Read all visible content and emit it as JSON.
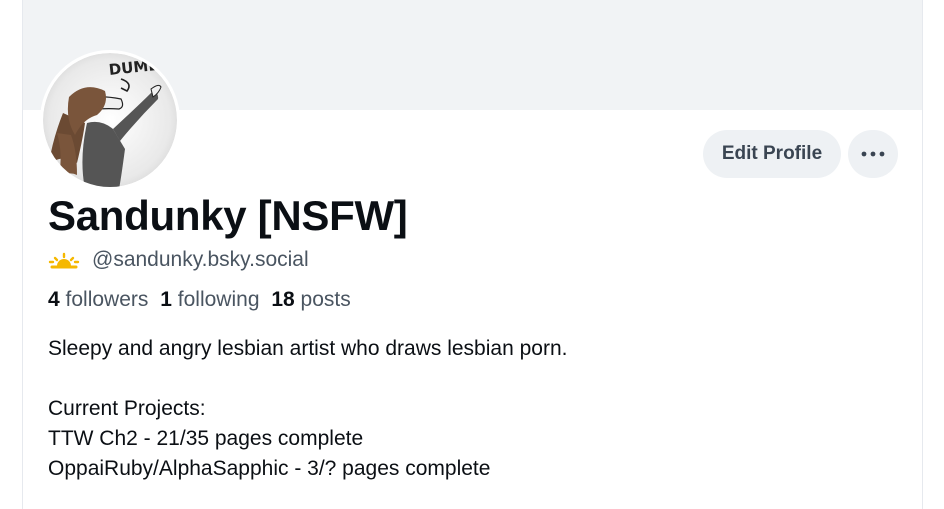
{
  "profile": {
    "display_name": "Sandunky [NSFW]",
    "handle": "@sandunky.bsky.social",
    "avatar_caption": "DUMB",
    "stats": {
      "followers_count": "4",
      "followers_label": "followers",
      "following_count": "1",
      "following_label": "following",
      "posts_count": "18",
      "posts_label": "posts"
    },
    "bio": {
      "line1": "Sleepy and angry lesbian artist who draws lesbian porn.",
      "line2": "Current Projects:",
      "line3": "TTW Ch2 - 21/35 pages complete",
      "line4": "OppaiRuby/AlphaSapphic - 3/? pages complete"
    }
  },
  "actions": {
    "edit_profile_label": "Edit Profile",
    "more_icon": "ellipsis-icon"
  },
  "colors": {
    "banner": "#f1f3f5",
    "button_bg": "#eef1f4",
    "text_primary": "#0b0f14",
    "text_secondary": "#4a5561",
    "sun_emoji": "#f5b800"
  }
}
